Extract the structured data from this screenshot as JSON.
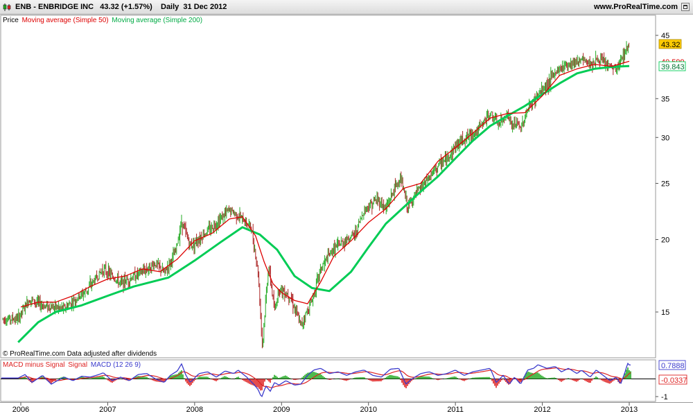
{
  "header": {
    "symbol": "ENB - ENBRIDGE INC",
    "quote": "43.32 (+1.57%)",
    "period": "Daily",
    "date": "31 Dec 2012",
    "site": "www.ProRealTime.com"
  },
  "price_legend": {
    "price": "Price",
    "ma50": "Moving average (Simple 50)",
    "ma200": "Moving average (Simple 200)"
  },
  "macd_legend": {
    "hist": "MACD minus Signal",
    "signal": "Signal",
    "macd": "MACD (12 26 9)"
  },
  "footer_note": "© ProRealTime.com  Data adjusted after dividends",
  "price_labels": {
    "last": "43.32",
    "ma50": "40.599",
    "ma200": "39.843"
  },
  "macd_labels": {
    "macd": "0.7888",
    "hist": "-0.0337"
  },
  "colors": {
    "up": "#22aa22",
    "down": "#aa2222",
    "ma50": "#dd0000",
    "ma200": "#00cc55",
    "macd": "#3a3acc",
    "signal": "#dd2222",
    "hist_pos": "#22aa22",
    "hist_neg": "#dd2222",
    "last_bg": "#ffcc00"
  },
  "chart_data": {
    "type": "line",
    "x_ticks": [
      "2006",
      "2007",
      "2008",
      "2009",
      "2010",
      "2011",
      "2012",
      "2013"
    ],
    "y_ticks": [
      "15",
      "20",
      "25",
      "30",
      "35",
      "45"
    ],
    "y_scale": "log",
    "macd_ticks": [
      "-1"
    ],
    "series": [
      {
        "name": "Moving average (Simple 50)",
        "points": [
          [
            2006.0,
            15.3
          ],
          [
            2006.2,
            15.6
          ],
          [
            2006.4,
            15.6
          ],
          [
            2006.6,
            16.0
          ],
          [
            2006.8,
            16.6
          ],
          [
            2007.0,
            17.1
          ],
          [
            2007.2,
            17.3
          ],
          [
            2007.4,
            17.8
          ],
          [
            2007.6,
            17.6
          ],
          [
            2007.8,
            18.5
          ],
          [
            2008.0,
            19.9
          ],
          [
            2008.2,
            20.5
          ],
          [
            2008.4,
            21.7
          ],
          [
            2008.55,
            21.9
          ],
          [
            2008.7,
            20.3
          ],
          [
            2008.8,
            18.3
          ],
          [
            2008.9,
            16.8
          ],
          [
            2009.0,
            16.2
          ],
          [
            2009.15,
            15.7
          ],
          [
            2009.3,
            15.5
          ],
          [
            2009.45,
            16.9
          ],
          [
            2009.6,
            18.7
          ],
          [
            2009.8,
            19.9
          ],
          [
            2010.0,
            21.4
          ],
          [
            2010.2,
            22.6
          ],
          [
            2010.4,
            24.5
          ],
          [
            2010.6,
            25.0
          ],
          [
            2010.8,
            27.3
          ],
          [
            2011.0,
            28.8
          ],
          [
            2011.2,
            30.5
          ],
          [
            2011.4,
            32.4
          ],
          [
            2011.6,
            33.0
          ],
          [
            2011.8,
            33.1
          ],
          [
            2012.0,
            35.4
          ],
          [
            2012.2,
            38.4
          ],
          [
            2012.4,
            39.4
          ],
          [
            2012.6,
            40.1
          ],
          [
            2012.8,
            39.8
          ],
          [
            2013.0,
            40.6
          ]
        ]
      },
      {
        "name": "Moving average (Simple 200)",
        "points": [
          [
            2005.97,
            13.3
          ],
          [
            2006.2,
            14.4
          ],
          [
            2006.4,
            15.0
          ],
          [
            2006.7,
            15.4
          ],
          [
            2007.0,
            16.0
          ],
          [
            2007.3,
            16.6
          ],
          [
            2007.7,
            17.2
          ],
          [
            2008.0,
            18.4
          ],
          [
            2008.3,
            19.8
          ],
          [
            2008.55,
            21.0
          ],
          [
            2008.75,
            20.4
          ],
          [
            2008.95,
            19.2
          ],
          [
            2009.15,
            17.3
          ],
          [
            2009.35,
            16.5
          ],
          [
            2009.55,
            16.3
          ],
          [
            2009.8,
            17.6
          ],
          [
            2010.0,
            19.4
          ],
          [
            2010.2,
            21.3
          ],
          [
            2010.4,
            22.7
          ],
          [
            2010.6,
            24.2
          ],
          [
            2010.8,
            25.7
          ],
          [
            2011.0,
            27.6
          ],
          [
            2011.2,
            29.6
          ],
          [
            2011.4,
            31.4
          ],
          [
            2011.6,
            32.7
          ],
          [
            2011.8,
            34.0
          ],
          [
            2012.0,
            35.6
          ],
          [
            2012.2,
            37.2
          ],
          [
            2012.4,
            38.7
          ],
          [
            2012.6,
            39.4
          ],
          [
            2012.8,
            39.7
          ],
          [
            2013.0,
            39.84
          ]
        ]
      },
      {
        "name": "Price",
        "points": [
          [
            2005.97,
            14.6
          ],
          [
            2006.1,
            15.8
          ],
          [
            2006.25,
            15.4
          ],
          [
            2006.5,
            15.2
          ],
          [
            2006.75,
            16.3
          ],
          [
            2006.95,
            17.8
          ],
          [
            2007.15,
            16.8
          ],
          [
            2007.4,
            17.6
          ],
          [
            2007.55,
            18.2
          ],
          [
            2007.65,
            17.5
          ],
          [
            2007.78,
            19.0
          ],
          [
            2007.85,
            21.5
          ],
          [
            2007.95,
            19.5
          ],
          [
            2008.2,
            21.0
          ],
          [
            2008.4,
            22.5
          ],
          [
            2008.5,
            22.0
          ],
          [
            2008.65,
            21.0
          ],
          [
            2008.73,
            17.5
          ],
          [
            2008.78,
            13.0
          ],
          [
            2008.85,
            18.0
          ],
          [
            2008.92,
            15.0
          ],
          [
            2008.97,
            16.5
          ],
          [
            2009.1,
            16.0
          ],
          [
            2009.22,
            14.2
          ],
          [
            2009.35,
            15.7
          ],
          [
            2009.45,
            17.8
          ],
          [
            2009.6,
            19.3
          ],
          [
            2009.75,
            20.0
          ],
          [
            2009.85,
            20.5
          ],
          [
            2009.95,
            22.5
          ],
          [
            2010.1,
            23.5
          ],
          [
            2010.2,
            22.6
          ],
          [
            2010.3,
            24.5
          ],
          [
            2010.37,
            25.5
          ],
          [
            2010.45,
            22.7
          ],
          [
            2010.55,
            24.0
          ],
          [
            2010.7,
            25.6
          ],
          [
            2010.8,
            26.8
          ],
          [
            2010.9,
            27.5
          ],
          [
            2011.0,
            29.0
          ],
          [
            2011.1,
            29.9
          ],
          [
            2011.25,
            30.8
          ],
          [
            2011.4,
            33.0
          ],
          [
            2011.5,
            31.5
          ],
          [
            2011.6,
            33.0
          ],
          [
            2011.65,
            31.2
          ],
          [
            2011.7,
            31.8
          ],
          [
            2011.75,
            31.0
          ],
          [
            2011.83,
            33.5
          ],
          [
            2011.95,
            35.5
          ],
          [
            2012.05,
            37.0
          ],
          [
            2012.15,
            38.8
          ],
          [
            2012.25,
            40.0
          ],
          [
            2012.35,
            40.5
          ],
          [
            2012.45,
            40.8
          ],
          [
            2012.55,
            40.3
          ],
          [
            2012.65,
            40.8
          ],
          [
            2012.75,
            40.0
          ],
          [
            2012.85,
            39.2
          ],
          [
            2012.9,
            40.5
          ],
          [
            2012.95,
            42.3
          ],
          [
            2013.0,
            43.32
          ]
        ]
      },
      {
        "name": "MACD (12 26 9)",
        "points": [
          [
            2005.97,
            0.05
          ],
          [
            2006.05,
            0.25
          ],
          [
            2006.13,
            -0.2
          ],
          [
            2006.25,
            0.2
          ],
          [
            2006.35,
            -0.3
          ],
          [
            2006.42,
            -0.1
          ],
          [
            2006.5,
            0.1
          ],
          [
            2006.6,
            -0.1
          ],
          [
            2006.7,
            0.15
          ],
          [
            2006.8,
            0.1
          ],
          [
            2006.9,
            0.25
          ],
          [
            2006.95,
            0.35
          ],
          [
            2007.05,
            -0.1
          ],
          [
            2007.15,
            0.1
          ],
          [
            2007.25,
            -0.1
          ],
          [
            2007.35,
            0.25
          ],
          [
            2007.45,
            0.3
          ],
          [
            2007.55,
            0.0
          ],
          [
            2007.65,
            -0.2
          ],
          [
            2007.72,
            0.2
          ],
          [
            2007.8,
            0.45
          ],
          [
            2007.85,
            0.85
          ],
          [
            2007.9,
            0.2
          ],
          [
            2007.95,
            -0.2
          ],
          [
            2008.05,
            0.3
          ],
          [
            2008.15,
            0.4
          ],
          [
            2008.25,
            0.1
          ],
          [
            2008.35,
            0.45
          ],
          [
            2008.45,
            0.3
          ],
          [
            2008.5,
            0.5
          ],
          [
            2008.6,
            0.1
          ],
          [
            2008.68,
            -0.3
          ],
          [
            2008.73,
            -0.6
          ],
          [
            2008.77,
            -1.05
          ],
          [
            2008.82,
            -0.4
          ],
          [
            2008.87,
            -0.7
          ],
          [
            2008.92,
            -0.2
          ],
          [
            2008.97,
            -0.35
          ],
          [
            2009.05,
            -0.1
          ],
          [
            2009.15,
            -0.35
          ],
          [
            2009.22,
            -0.3
          ],
          [
            2009.3,
            0.2
          ],
          [
            2009.37,
            0.5
          ],
          [
            2009.45,
            0.6
          ],
          [
            2009.55,
            0.3
          ],
          [
            2009.65,
            0.4
          ],
          [
            2009.75,
            0.2
          ],
          [
            2009.85,
            0.4
          ],
          [
            2009.95,
            0.5
          ],
          [
            2010.05,
            0.2
          ],
          [
            2010.15,
            0.1
          ],
          [
            2010.25,
            0.55
          ],
          [
            2010.35,
            0.6
          ],
          [
            2010.43,
            -0.3
          ],
          [
            2010.5,
            0.0
          ],
          [
            2010.6,
            0.3
          ],
          [
            2010.7,
            0.4
          ],
          [
            2010.8,
            0.2
          ],
          [
            2010.9,
            0.3
          ],
          [
            2011.0,
            0.5
          ],
          [
            2011.1,
            0.2
          ],
          [
            2011.2,
            0.4
          ],
          [
            2011.3,
            0.5
          ],
          [
            2011.4,
            0.6
          ],
          [
            2011.47,
            -0.2
          ],
          [
            2011.55,
            0.2
          ],
          [
            2011.62,
            -0.3
          ],
          [
            2011.68,
            0.1
          ],
          [
            2011.75,
            -0.3
          ],
          [
            2011.83,
            0.5
          ],
          [
            2011.9,
            0.6
          ],
          [
            2011.95,
            0.8
          ],
          [
            2012.05,
            0.6
          ],
          [
            2012.15,
            0.7
          ],
          [
            2012.22,
            0.4
          ],
          [
            2012.3,
            0.6
          ],
          [
            2012.4,
            0.3
          ],
          [
            2012.45,
            0.5
          ],
          [
            2012.55,
            0.1
          ],
          [
            2012.62,
            0.5
          ],
          [
            2012.7,
            0.2
          ],
          [
            2012.78,
            -0.1
          ],
          [
            2012.85,
            0.1
          ],
          [
            2012.9,
            -0.3
          ],
          [
            2012.96,
            0.5
          ],
          [
            2012.98,
            0.9
          ],
          [
            2013.0,
            0.79
          ]
        ]
      }
    ]
  }
}
